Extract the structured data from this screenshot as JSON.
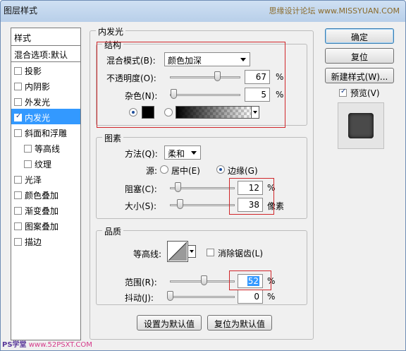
{
  "window": {
    "title": "图层样式",
    "watermark_top": "思缘设计论坛 www.MISSYUAN.COM",
    "watermark_bottom": "PS学堂",
    "watermark_bottom_url": "www.52PSXT.COM"
  },
  "style_list": {
    "header": "样式",
    "blend_options": "混合选项:默认",
    "items": [
      {
        "label": "投影",
        "checked": false
      },
      {
        "label": "内阴影",
        "checked": false
      },
      {
        "label": "外发光",
        "checked": false
      },
      {
        "label": "内发光",
        "checked": true,
        "active": true
      },
      {
        "label": "斜面和浮雕",
        "checked": false
      },
      {
        "label": "等高线",
        "checked": false,
        "sub": true
      },
      {
        "label": "纹理",
        "checked": false,
        "sub": true
      },
      {
        "label": "光泽",
        "checked": false
      },
      {
        "label": "颜色叠加",
        "checked": false
      },
      {
        "label": "渐变叠加",
        "checked": false
      },
      {
        "label": "图案叠加",
        "checked": false
      },
      {
        "label": "描边",
        "checked": false
      }
    ]
  },
  "panel": {
    "title": "内发光"
  },
  "structure": {
    "title": "结构",
    "blend_mode_label": "混合模式(B):",
    "blend_mode_value": "颜色加深",
    "opacity_label": "不透明度(O):",
    "opacity_value": "67",
    "opacity_unit": "%",
    "noise_label": "杂色(N):",
    "noise_value": "5",
    "noise_unit": "%",
    "color_mode": "solid",
    "swatch_color": "#000000"
  },
  "elements": {
    "title": "图素",
    "method_label": "方法(Q):",
    "method_value": "柔和",
    "source_label": "源:",
    "source_center": "居中(E)",
    "source_edge": "边缘(G)",
    "source_value": "edge",
    "choke_label": "阻塞(C):",
    "choke_value": "12",
    "choke_unit": "%",
    "size_label": "大小(S):",
    "size_value": "38",
    "size_unit": "像素"
  },
  "quality": {
    "title": "品质",
    "contour_label": "等高线:",
    "anti_alias_label": "消除锯齿(L)",
    "anti_alias_checked": false,
    "range_label": "范围(R):",
    "range_value": "52",
    "range_unit": "%",
    "jitter_label": "抖动(J):",
    "jitter_value": "0",
    "jitter_unit": "%"
  },
  "sliders": {
    "opacity": 67,
    "noise": 5,
    "choke": 12,
    "size": 38,
    "size_max": 250,
    "range": 52,
    "jitter": 0
  },
  "buttons": {
    "make_default": "设置为默认值",
    "reset_default": "复位为默认值",
    "ok": "确定",
    "reset": "复位",
    "new_style": "新建样式(W)...",
    "preview_label": "预览(V)",
    "preview_checked": true
  },
  "colors": {
    "highlight": "#3399ff",
    "annotation_red": "#d0262a",
    "glow": "#000000"
  }
}
